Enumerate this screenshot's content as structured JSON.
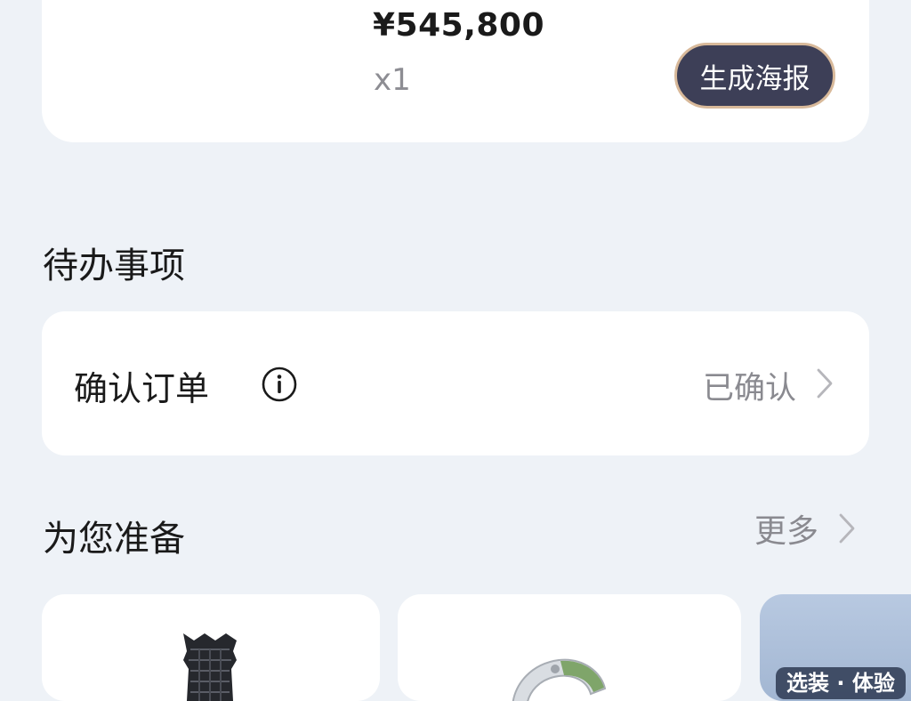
{
  "order": {
    "price": "¥545,800",
    "quantity": "x1",
    "poster_button_label": "生成海报"
  },
  "todo": {
    "title": "待办事项",
    "item_label": "确认订单",
    "item_status": "已确认"
  },
  "prepared": {
    "title": "为您准备",
    "more_label": "更多",
    "promo_tag": "选装 · 体验"
  },
  "colors": {
    "background": "#eef2f7",
    "card": "#ffffff",
    "button_bg": "#3d3f57",
    "button_border": "#d8b99a",
    "secondary_text": "#8a8a90"
  },
  "icons": {
    "info": "info-circle-icon",
    "chevron": "chevron-right-icon"
  }
}
